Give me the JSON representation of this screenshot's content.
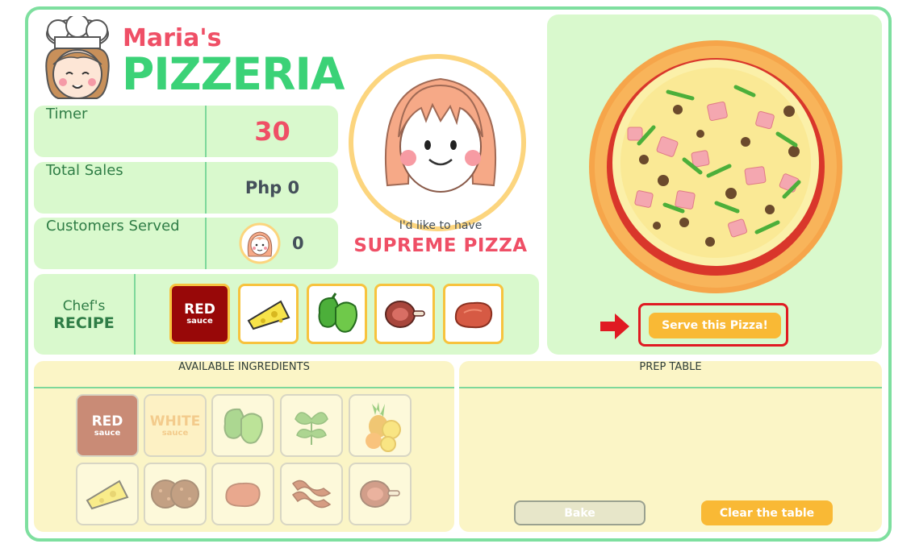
{
  "logo": {
    "line1": "Maria's",
    "line2": "PIZZERIA"
  },
  "stats": {
    "timer_label": "Timer",
    "timer_value": "30",
    "sales_label": "Total Sales",
    "sales_value": "Php 0",
    "served_label": "Customers Served",
    "served_value": "0"
  },
  "order": {
    "intro": "I'd like to have",
    "name": "SUPREME PIZZA"
  },
  "recipe": {
    "label_line1": "Chef's",
    "label_line2": "RECIPE",
    "items": [
      {
        "icon": "red-sauce-icon",
        "big": "RED",
        "small": "sauce"
      },
      {
        "icon": "cheese-icon"
      },
      {
        "icon": "green-pepper-icon"
      },
      {
        "icon": "ham-icon"
      },
      {
        "icon": "meat-icon"
      }
    ]
  },
  "pizza_panel": {
    "serve_label": "Serve this Pizza!"
  },
  "available": {
    "title": "AVAILABLE INGREDIENTS",
    "red_big": "RED",
    "red_small": "sauce",
    "white_big": "WHITE",
    "white_small": "sauce",
    "items": [
      "red-sauce-icon",
      "white-sauce-icon",
      "green-pepper-icon",
      "parsley-icon",
      "pineapple-icon",
      "cheese-icon",
      "pepperoni-icon",
      "meat-icon",
      "bacon-icon",
      "ham-icon"
    ]
  },
  "prep": {
    "title": "PREP TABLE",
    "bake_label": "Bake",
    "clear_label": "Clear the table"
  },
  "colors": {
    "accent_green": "#3bd277",
    "accent_red": "#ef4f66",
    "button_orange": "#f9b935",
    "highlight_red": "#e01a22"
  }
}
